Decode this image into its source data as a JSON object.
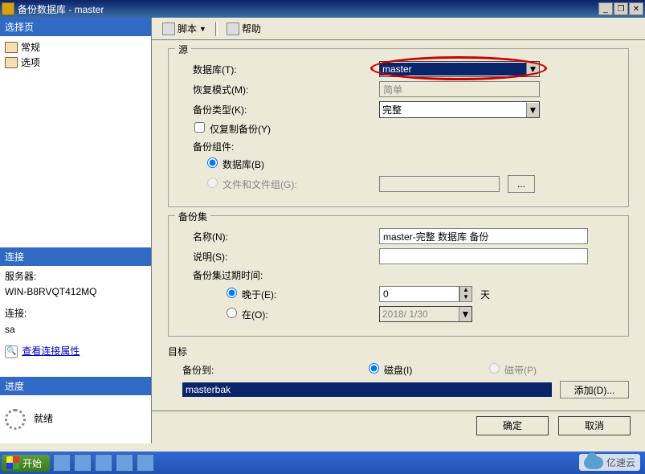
{
  "window": {
    "title": "备份数据库 - master",
    "min": "_",
    "max": "❐",
    "close": "✕"
  },
  "sidebar": {
    "select_page": "选择页",
    "items": [
      {
        "label": "常规"
      },
      {
        "label": "选项"
      }
    ],
    "connection": {
      "heading": "连接",
      "server_label": "服务器:",
      "server_value": "WIN-B8RVQT412MQ",
      "conn_label": "连接:",
      "conn_value": "sa",
      "view_link": "查看连接属性"
    },
    "progress": {
      "heading": "进度",
      "status": "就绪"
    }
  },
  "toolbar": {
    "script": "脚本",
    "script_drop": "▼",
    "help": "帮助"
  },
  "form": {
    "source": {
      "title": "源",
      "db_label": "数据库(T):",
      "db_value": "master",
      "recovery_label": "恢复模式(M):",
      "recovery_value": "简单",
      "type_label": "备份类型(K):",
      "type_value": "完整",
      "copy_only": "仅复制备份(Y)",
      "component_label": "备份组件:",
      "db_radio": "数据库(B)",
      "fg_radio": "文件和文件组(G):",
      "ellipsis": "..."
    },
    "set": {
      "title": "备份集",
      "name_label": "名称(N):",
      "name_value": "master-完整 数据库 备份",
      "desc_label": "说明(S):",
      "desc_value": "",
      "expire_label": "备份集过期时间:",
      "after_radio": "晚于(E):",
      "after_value": "0",
      "after_unit": "天",
      "on_radio": "在(O):",
      "on_value": "2018/ 1/30"
    },
    "target": {
      "title": "目标",
      "backup_to_label": "备份到:",
      "disk_radio": "磁盘(I)",
      "tape_radio": "磁带(P)",
      "dest_value": "masterbak",
      "add_btn": "添加(D)..."
    }
  },
  "footer": {
    "ok": "确定",
    "cancel": "取消"
  },
  "taskbar": {
    "start": "开始"
  },
  "watermark": "亿速云"
}
